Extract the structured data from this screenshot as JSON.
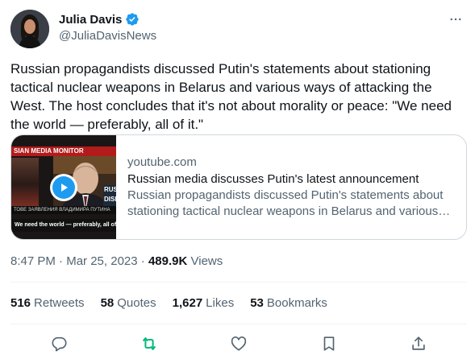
{
  "author": {
    "name": "Julia Davis",
    "handle": "@JuliaDavisNews"
  },
  "tweet": {
    "text": "Russian propagandists discussed Putin's statements about stationing tactical nuclear weapons in Belarus and various ways of attacking the West. The host concludes that it's not about morality or peace: \"We need the world — preferably, all of it.\""
  },
  "card": {
    "domain": "youtube.com",
    "title": "Russian media discusses Putin's latest announcement",
    "description": "Russian propagandists discussed Putin's statements about stationing tactical nuclear weapons in Belarus and various ways of attacking the West.",
    "thumbnail": {
      "banner_text": "SIAN MEDIA MONITOR",
      "caption_top": "ТОВЕ ЗАЯВЛЕНИЯ ВЛАДИМИРА ПУТИНА",
      "caption": "We need the world — preferably, all of it",
      "side_text": "RUSS DISI"
    }
  },
  "meta": {
    "time": "8:47 PM",
    "date": "Mar 25, 2023",
    "views_count": "489.9K",
    "views_label": "Views"
  },
  "stats": {
    "retweets_count": "516",
    "retweets_label": "Retweets",
    "quotes_count": "58",
    "quotes_label": "Quotes",
    "likes_count": "1,627",
    "likes_label": "Likes",
    "bookmarks_count": "53",
    "bookmarks_label": "Bookmarks"
  },
  "icons": {
    "verified": "verified-badge-icon",
    "more": "more-dots-icon",
    "reply": "reply-icon",
    "retweet": "retweet-icon",
    "like": "heart-icon",
    "bookmark": "bookmark-icon",
    "share": "share-icon",
    "play": "play-icon"
  },
  "colors": {
    "accent": "#1d9bf0",
    "retweet_active": "#00ba7c",
    "secondary_text": "#536471",
    "primary_text": "#0f1419",
    "border": "#cfd9de"
  }
}
